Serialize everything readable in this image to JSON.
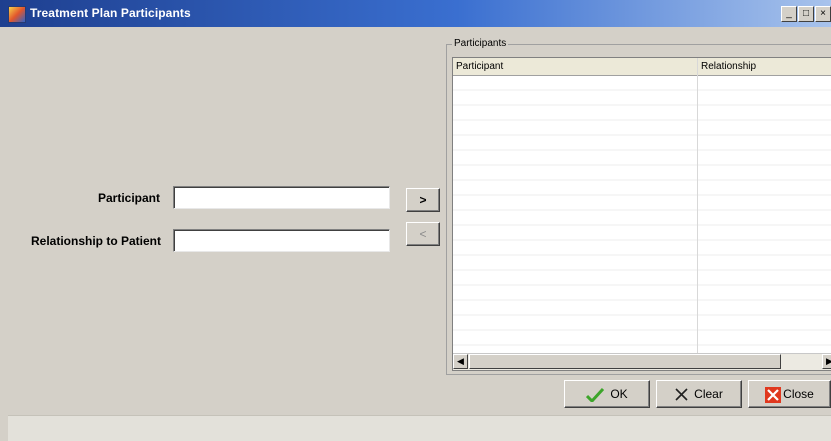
{
  "window": {
    "title": "Treatment Plan Participants",
    "controls": {
      "minimize": "_",
      "maximize": "□",
      "close": "×"
    }
  },
  "form": {
    "participant_label": "Participant",
    "participant_value": "",
    "relationship_label": "Relationship to Patient",
    "relationship_value": ""
  },
  "transfer": {
    "add_label": ">",
    "remove_label": "<"
  },
  "participants": {
    "group_title": "Participants",
    "columns": [
      "Participant",
      "Relationship"
    ],
    "rows": []
  },
  "scrollbar": {
    "left_arrow": "◀",
    "right_arrow": "▶"
  },
  "buttons": {
    "ok": "OK",
    "clear": "Clear",
    "close": "Close"
  },
  "colors": {
    "titlebar_start": "#1e3f8f",
    "window_bg": "#d4d0c8",
    "ok_check": "#3da52a",
    "close_icon": "#e0381e"
  }
}
